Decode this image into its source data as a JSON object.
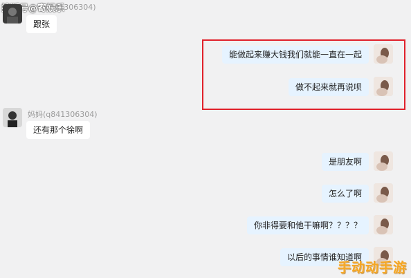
{
  "watermark_top": "搜狐号@寄娱乐",
  "watermark_bottom": "手动动手游",
  "messages": [
    {
      "side": "left",
      "sender": "(q841306304)",
      "text": "跟张",
      "show_sender": true
    },
    {
      "side": "right",
      "text": "能做起来赚大钱我们就能一直在一起"
    },
    {
      "side": "right",
      "text": "做不起来就再说呗"
    },
    {
      "side": "left",
      "sender": "妈妈(q841306304)",
      "text": "还有那个徐啊",
      "show_sender": true
    },
    {
      "side": "right",
      "text": "是朋友啊"
    },
    {
      "side": "right",
      "text": "怎么了啊"
    },
    {
      "side": "right",
      "text": "你非得要和他干嘛啊？？？？"
    },
    {
      "side": "right",
      "text": "以后的事情谁知道啊"
    }
  ],
  "colors": {
    "background": "#f1f1f2",
    "left_bubble": "#ffffff",
    "right_bubble": "#e6f3ff",
    "highlight_border": "#e0202a"
  }
}
